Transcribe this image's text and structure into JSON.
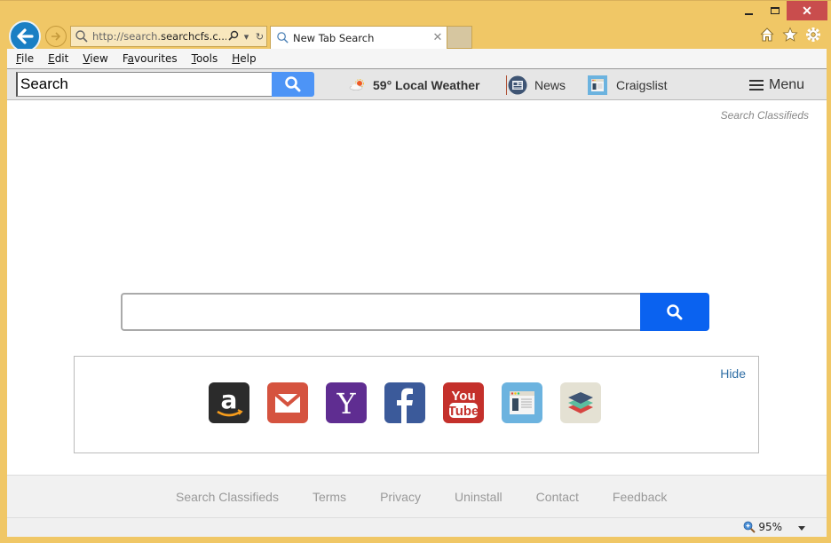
{
  "browser": {
    "address_url_prefix": "http://search.",
    "address_url_domain": "searchcfs.c...",
    "tab_title": "New Tab Search",
    "window_controls": {
      "minimize": "minimize-icon",
      "maximize": "maximize-icon",
      "close": "✕"
    }
  },
  "menubar": {
    "items": [
      {
        "label": "File",
        "accel": "F",
        "rest": "ile"
      },
      {
        "label": "Edit",
        "accel": "E",
        "rest": "dit"
      },
      {
        "label": "View",
        "accel": "V",
        "rest": "iew"
      },
      {
        "label": "Favourites",
        "accel": "a",
        "pre": "F",
        "rest": "vourites"
      },
      {
        "label": "Tools",
        "accel": "T",
        "rest": "ools"
      },
      {
        "label": "Help",
        "accel": "H",
        "rest": "elp"
      }
    ]
  },
  "toolbar": {
    "search_value": "Search",
    "weather_label": "59° Local Weather",
    "news_label": "News",
    "craigslist_label": "Craigslist",
    "menu_label": "Menu"
  },
  "page": {
    "search_classifieds": "Search Classifieds",
    "main_search_value": "",
    "hide_label": "Hide",
    "shortcuts": [
      {
        "name": "amazon",
        "color": "#2b2b2b"
      },
      {
        "name": "gmail",
        "color": "#d5533f"
      },
      {
        "name": "yahoo",
        "color": "#5f2d91"
      },
      {
        "name": "facebook",
        "color": "#3b5a9a"
      },
      {
        "name": "youtube",
        "color": "#c4302b"
      },
      {
        "name": "classifieds",
        "color": "#6cb3df"
      },
      {
        "name": "layers",
        "color": "#e4e1d3"
      }
    ]
  },
  "footer": {
    "links": [
      "Search Classifieds",
      "Terms",
      "Privacy",
      "Uninstall",
      "Contact",
      "Feedback"
    ]
  },
  "statusbar": {
    "zoom": "95%"
  }
}
